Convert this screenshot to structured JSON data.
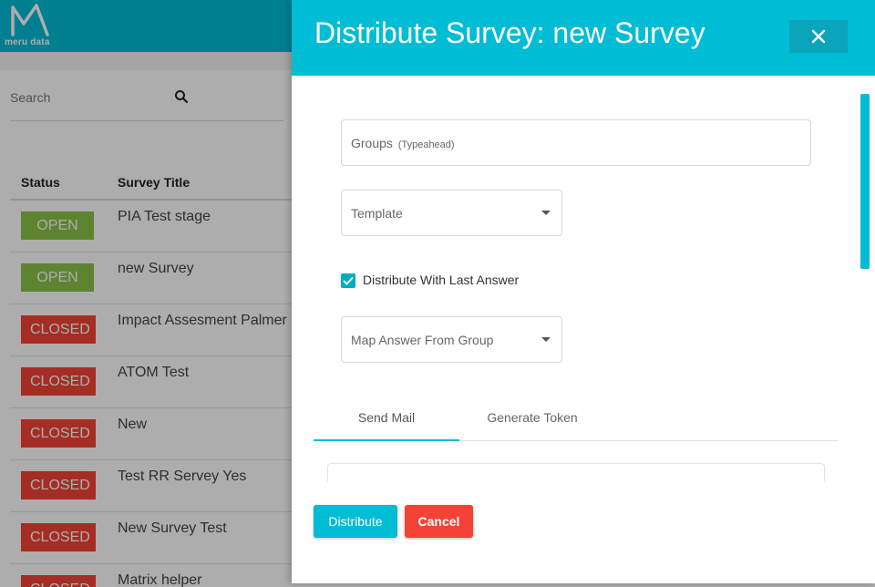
{
  "app": {
    "logo_text": "meru data",
    "brand_color": "#00bcd4"
  },
  "search": {
    "placeholder": "Search",
    "icon": "search-icon"
  },
  "table": {
    "headers": {
      "status": "Status",
      "title": "Survey Title"
    },
    "rows": [
      {
        "status": "OPEN",
        "title": "PIA Test stage"
      },
      {
        "status": "OPEN",
        "title": "new Survey"
      },
      {
        "status": "CLOSED",
        "title": "Impact Assesment Palmer"
      },
      {
        "status": "CLOSED",
        "title": "ATOM Test"
      },
      {
        "status": "CLOSED",
        "title": "New"
      },
      {
        "status": "CLOSED",
        "title": "Test RR Servey Yes"
      },
      {
        "status": "CLOSED",
        "title": "New Survey Test"
      },
      {
        "status": "CLOSED",
        "title": "Matrix helper"
      }
    ],
    "status_colors": {
      "OPEN": "#8bc34a",
      "CLOSED": "#f44336"
    }
  },
  "modal": {
    "title": "Distribute Survey: new Survey",
    "close_icon": "close-icon",
    "groups": {
      "label": "Groups",
      "hint": "(Typeahead)"
    },
    "template": {
      "label": "Template"
    },
    "distribute_with_last_answer": {
      "label": "Distribute With Last Answer",
      "checked": true
    },
    "map_answer": {
      "label": "Map Answer From Group"
    },
    "tabs": [
      {
        "label": "Send Mail",
        "active": true
      },
      {
        "label": "Generate Token",
        "active": false
      }
    ],
    "distribute_label": "Distribute",
    "cancel_label": "Cancel"
  }
}
